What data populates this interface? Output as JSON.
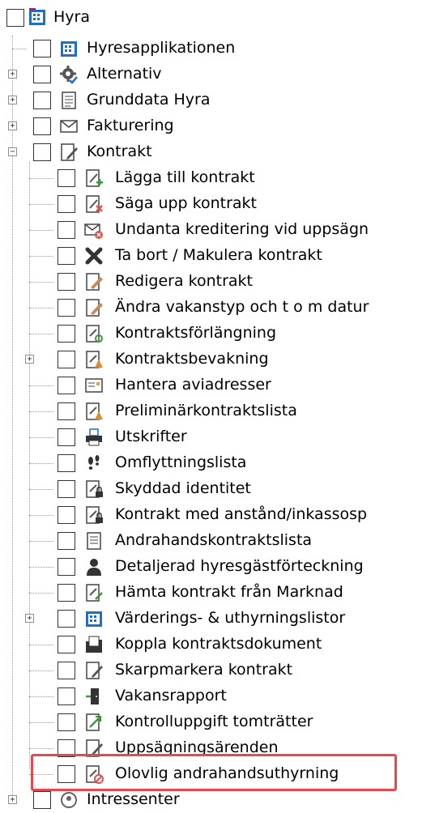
{
  "tree": {
    "root": {
      "label": "Hyra",
      "icon": "building-icon"
    },
    "level1": [
      {
        "label": "Hyresapplikationen",
        "icon": "building-icon"
      },
      {
        "label": "Alternativ",
        "icon": "gear-check-icon"
      },
      {
        "label": "Grunddata Hyra",
        "icon": "document-list-icon"
      },
      {
        "label": "Fakturering",
        "icon": "envelope-icon"
      },
      {
        "label": "Kontrakt",
        "icon": "document-pencil-icon"
      }
    ],
    "kontrakt_children": [
      {
        "label": "Lägga till kontrakt",
        "icon": "document-add-icon"
      },
      {
        "label": "Säga upp kontrakt",
        "icon": "document-cancel-icon"
      },
      {
        "label": "Undanta kreditering vid uppsägn",
        "icon": "envelope-blocked-icon"
      },
      {
        "label": "Ta bort / Makulera kontrakt",
        "icon": "x-icon"
      },
      {
        "label": "Redigera kontrakt",
        "icon": "document-edit-icon"
      },
      {
        "label": "Ändra vakanstyp och t o m datur",
        "icon": "document-edit-icon"
      },
      {
        "label": "Kontraktsförlängning",
        "icon": "document-refresh-icon"
      },
      {
        "label": "Kontraktsbevakning",
        "icon": "document-warning-icon"
      },
      {
        "label": "Hantera aviadresser",
        "icon": "address-card-icon"
      },
      {
        "label": "Preliminärkontraktslista",
        "icon": "document-warning-icon"
      },
      {
        "label": "Utskrifter",
        "icon": "printer-icon"
      },
      {
        "label": "Omflyttningslista",
        "icon": "footprints-icon"
      },
      {
        "label": "Skyddad identitet",
        "icon": "document-lock-icon"
      },
      {
        "label": "Kontrakt med anstånd/inkassosp",
        "icon": "document-lock-icon"
      },
      {
        "label": "Andrahandskontraktslista",
        "icon": "document-list-icon"
      },
      {
        "label": "Detaljerad hyresgästförteckning",
        "icon": "person-icon"
      },
      {
        "label": "Hämta kontrakt från Marknad",
        "icon": "document-import-icon"
      },
      {
        "label": "Värderings- & uthyrningslistor",
        "icon": "building-icon"
      },
      {
        "label": "Koppla kontraktsdokument",
        "icon": "folder-document-icon"
      },
      {
        "label": "Skarpmarkera kontrakt",
        "icon": "document-pencil-icon"
      },
      {
        "label": "Vakansrapport",
        "icon": "door-exit-icon"
      },
      {
        "label": "Kontrolluppgift tomträtter",
        "icon": "document-arrow-icon"
      },
      {
        "label": "Uppsägningsärenden",
        "icon": "document-pencil-icon"
      },
      {
        "label": "Olovlig andrahandsuthyrning",
        "icon": "document-forbidden-icon"
      }
    ],
    "last_level1": {
      "label": "Intressenter",
      "icon": "people-icon"
    }
  },
  "colors": {
    "highlight": "#e5484d",
    "icon_blue": "#1f6fc4",
    "icon_red": "#d9534f"
  }
}
